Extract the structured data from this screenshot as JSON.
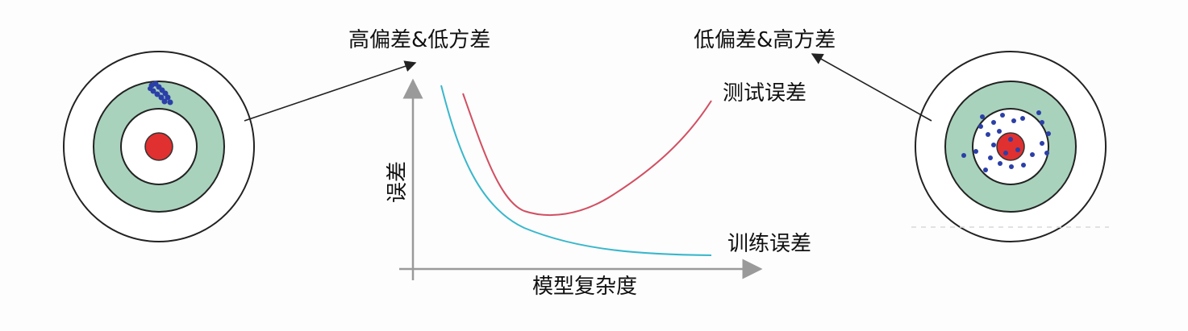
{
  "labels": {
    "high_bias_low_variance": "高偏差&低方差",
    "low_bias_high_variance": "低偏差&高方差",
    "test_error": "测试误差",
    "train_error": "训练误差",
    "y_axis": "误差",
    "x_axis": "模型复杂度"
  },
  "colors": {
    "ring_fill": "#a8d2bc",
    "bullseye": "#e03030",
    "dots": "#2b3fa8",
    "test_curve": "#d24f62",
    "train_curve": "#39b7cc",
    "axis": "#9a9a9a"
  },
  "targets": [
    {
      "name": "high-bias-low-variance",
      "pattern": "clustered off-center"
    },
    {
      "name": "low-bias-high-variance",
      "pattern": "scattered around center"
    }
  ]
}
